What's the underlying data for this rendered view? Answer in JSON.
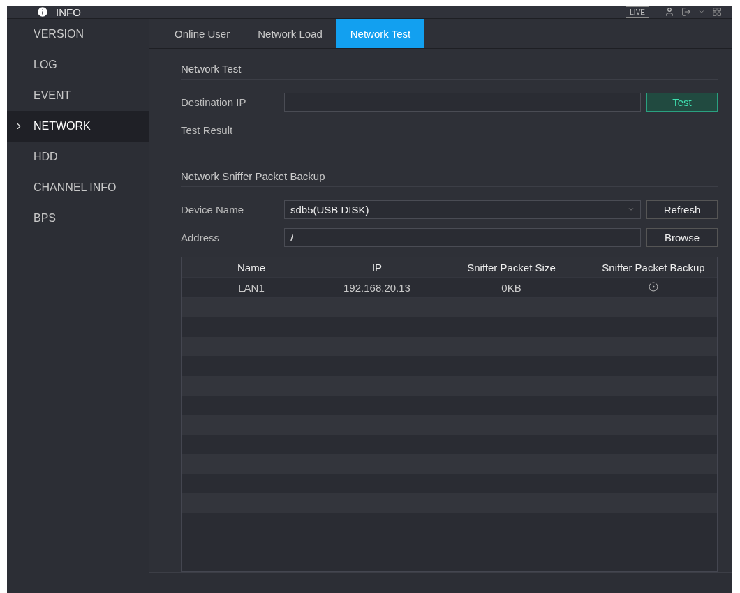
{
  "header": {
    "title": "INFO",
    "live_button": "LIVE"
  },
  "sidebar": {
    "items": [
      {
        "label": "VERSION",
        "selected": false
      },
      {
        "label": "LOG",
        "selected": false
      },
      {
        "label": "EVENT",
        "selected": false
      },
      {
        "label": "NETWORK",
        "selected": true
      },
      {
        "label": "HDD",
        "selected": false
      },
      {
        "label": "CHANNEL INFO",
        "selected": false
      },
      {
        "label": "BPS",
        "selected": false
      }
    ]
  },
  "tabs": [
    {
      "label": "Online User",
      "selected": false
    },
    {
      "label": "Network Load",
      "selected": false
    },
    {
      "label": "Network Test",
      "selected": true
    }
  ],
  "network_test": {
    "section_title": "Network Test",
    "destination_label": "Destination IP",
    "test_button": "Test",
    "result_label": "Test Result"
  },
  "sniffer": {
    "section_title": "Network Sniffer Packet Backup",
    "device_label": "Device Name",
    "device_value": "sdb5(USB DISK)",
    "refresh_button": "Refresh",
    "address_label": "Address",
    "address_value": "/",
    "browse_button": "Browse"
  },
  "table": {
    "columns": [
      "Name",
      "IP",
      "Sniffer Packet Size",
      "Sniffer Packet Backup"
    ],
    "rows": [
      {
        "name": "LAN1",
        "ip": "192.168.20.13",
        "size": "0KB"
      }
    ]
  }
}
